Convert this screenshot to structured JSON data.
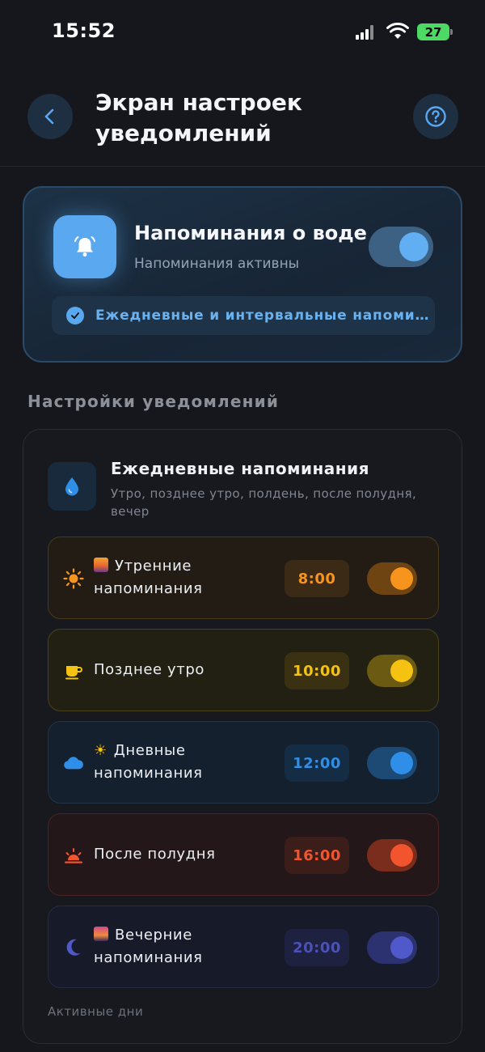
{
  "status_bar": {
    "time": "15:52",
    "battery": "27"
  },
  "header": {
    "title": "Экран настроек уведомлений"
  },
  "water_card": {
    "title": "Напоминания о воде",
    "subtitle": "Напоминания активны",
    "enabled": true,
    "mode": "Ежедневные и интервальные напомин..."
  },
  "section_label": "Настройки уведомлений",
  "daily": {
    "title": "Ежедневные напоминания",
    "subtitle": "Утро, позднее утро, полдень, после полудня, вечер"
  },
  "reminders": [
    {
      "label": "Утренние напоминания",
      "time": "8:00",
      "enabled": true,
      "icon": "sun-icon",
      "color": "#f7941d"
    },
    {
      "label": "Позднее утро",
      "time": "10:00",
      "enabled": true,
      "icon": "coffee-icon",
      "color": "#f5c211"
    },
    {
      "label": "Дневные напоминания",
      "time": "12:00",
      "enabled": true,
      "icon": "cloud-icon",
      "color": "#2f8fe8"
    },
    {
      "label": "После полудня",
      "time": "16:00",
      "enabled": true,
      "icon": "sunset-icon",
      "color": "#f2542d"
    },
    {
      "label": "Вечерние напоминания",
      "time": "20:00",
      "enabled": true,
      "icon": "moon-icon",
      "color": "#5059c9"
    }
  ],
  "active_days_label": "Активные дни"
}
